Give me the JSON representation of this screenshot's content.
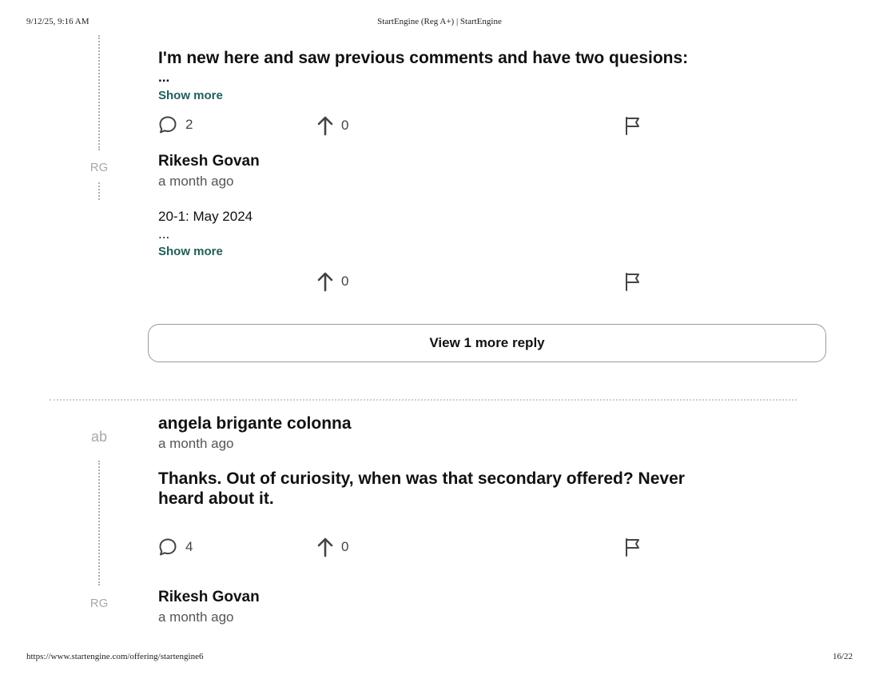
{
  "print_header": {
    "datetime": "9/12/25, 9:16 AM",
    "title": "StartEngine (Reg A+) | StartEngine"
  },
  "print_footer": {
    "url": "https://www.startengine.com/offering/startengine6",
    "page": "16/22"
  },
  "comments": [
    {
      "text": "I'm new here and saw previous comments and have two quesions:",
      "ellipsis": "...",
      "show_more": "Show more",
      "reply_count": "2",
      "upvotes": "0",
      "replies": [
        {
          "initials": "RG",
          "author": "Rikesh Govan",
          "time": "a month ago",
          "text": "20-1: May 2024",
          "ellipsis": "...",
          "show_more": "Show more",
          "upvotes": "0"
        }
      ],
      "view_more": "View 1 more reply"
    },
    {
      "initials": "ab",
      "author": "angela brigante colonna",
      "time": "a month ago",
      "text_line1": "Thanks. Out of curiosity, when was that secondary offered? Never",
      "text_line2": "heard about it.",
      "reply_count": "4",
      "upvotes": "0",
      "replies": [
        {
          "initials": "RG",
          "author": "Rikesh Govan",
          "time": "a month ago"
        }
      ]
    }
  ],
  "icons": {
    "reply": "speech-bubble-icon",
    "upvote": "arrow-up-icon",
    "flag": "flag-icon"
  },
  "colors": {
    "link": "#1f5f5a",
    "muted": "#a8a8a8"
  }
}
